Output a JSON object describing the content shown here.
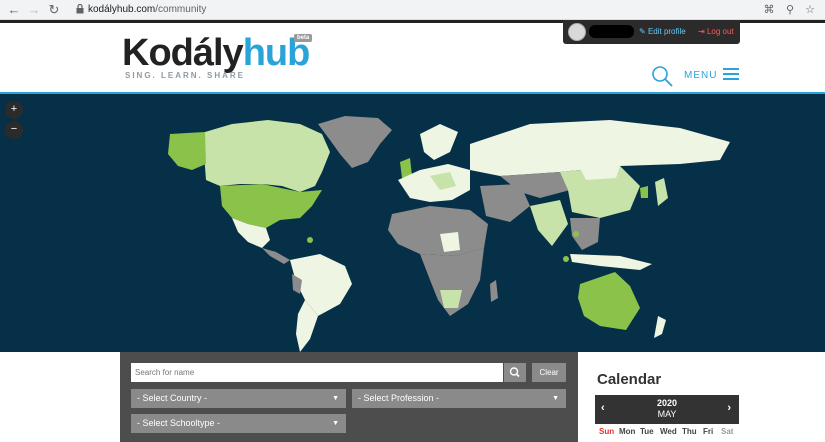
{
  "browser": {
    "url_host": "kodályhub.com",
    "url_path": "/community"
  },
  "userbar": {
    "edit_profile": "Edit profile",
    "logout": "Log out"
  },
  "logo": {
    "part1": "Kodály",
    "part2": "hub",
    "beta": "beta",
    "tagline": "SING. LEARN. SHARE"
  },
  "header": {
    "menu_label": "MENU"
  },
  "map": {
    "zoom_in": "+",
    "zoom_out": "−",
    "colors": {
      "ocean": "#053048",
      "no_data": "#8c8c8c",
      "low": "#eef5e3",
      "mid": "#c7e3a9",
      "high": "#8bc34a"
    }
  },
  "filters": {
    "search_placeholder": "Search for name",
    "clear_label": "Clear",
    "country": "- Select Country -",
    "profession": "- Select Profession -",
    "schooltype": "- Select Schooltype -"
  },
  "calendar": {
    "title": "Calendar",
    "year": "2020",
    "month": "MAY",
    "days": [
      "Sun",
      "Mon",
      "Tue",
      "Wed",
      "Thu",
      "Fri",
      "Sat"
    ]
  }
}
